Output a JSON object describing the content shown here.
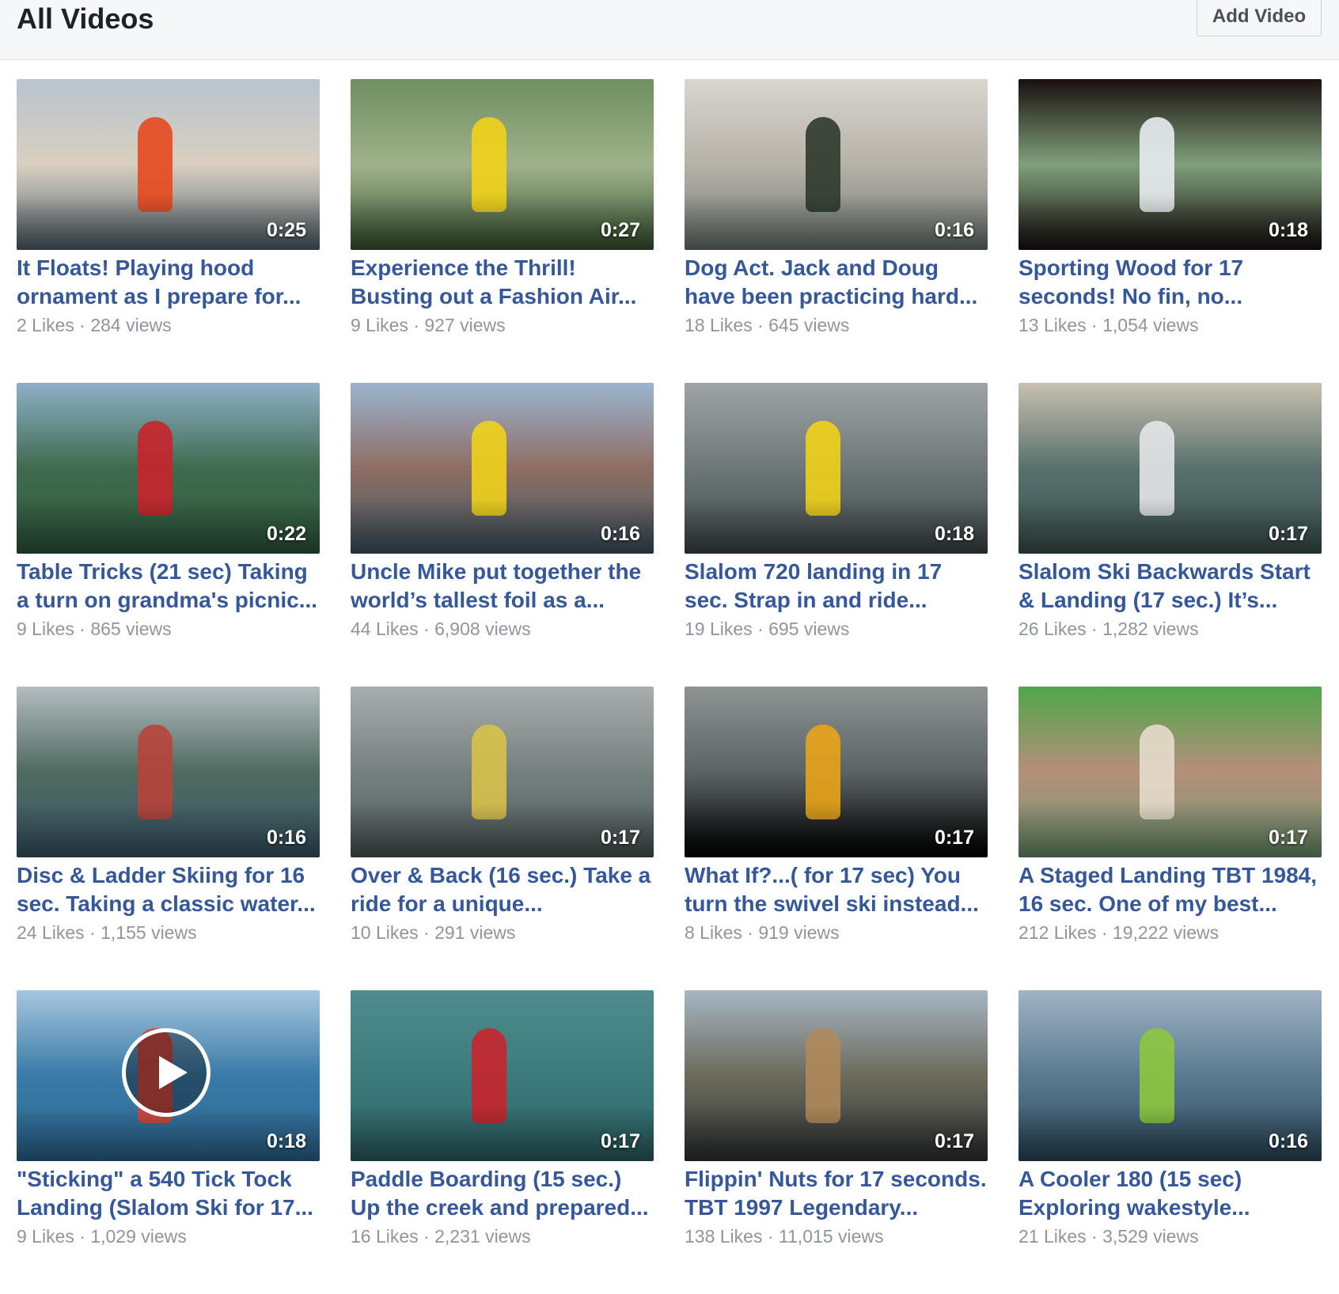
{
  "header": {
    "title": "All Videos",
    "add_button_label": "Add Video"
  },
  "videos": [
    {
      "duration": "0:25",
      "title": "It Floats! Playing hood ornament as I prepare for...",
      "likes": "2 Likes",
      "views": "284 views",
      "colors": [
        "#b9c4cf",
        "#d8cfc0",
        "#556872"
      ],
      "accent": "#e5491e"
    },
    {
      "duration": "0:27",
      "title": "Experience the Thrill! Busting out a Fashion Air...",
      "likes": "9 Likes",
      "views": "927 views",
      "colors": [
        "#6f8f62",
        "#9fb18a",
        "#3d5a34"
      ],
      "accent": "#f2d21a"
    },
    {
      "duration": "0:16",
      "title": "Dog Act. Jack and Doug have been practicing hard...",
      "likes": "18 Likes",
      "views": "645 views",
      "colors": [
        "#d9d6cf",
        "#b7b2a8",
        "#6f7b74"
      ],
      "accent": "#2e3a2c"
    },
    {
      "duration": "0:18",
      "title": "Sporting Wood for 17 seconds! No fin, no...",
      "likes": "13 Likes",
      "views": "1,054 views",
      "colors": [
        "#1a1010",
        "#7fa07a",
        "#1a1010"
      ],
      "accent": "#e8ecef"
    },
    {
      "duration": "0:22",
      "title": "Table Tricks (21 sec) Taking a turn on grandma's picnic...",
      "likes": "9 Likes",
      "views": "865 views",
      "colors": [
        "#8fb0c8",
        "#3f6a4e",
        "#2f5c3f"
      ],
      "accent": "#c9232b"
    },
    {
      "duration": "0:16",
      "title": "Uncle Mike put together the world’s tallest foil as a...",
      "likes": "44 Likes",
      "views": "6,908 views",
      "colors": [
        "#9cb4cf",
        "#8e6e64",
        "#3f5866"
      ],
      "accent": "#f0d21a"
    },
    {
      "duration": "0:18",
      "title": "Slalom 720 landing in 17 sec. Strap in and ride...",
      "likes": "19 Likes",
      "views": "695 views",
      "colors": [
        "#9ea4a6",
        "#6d7778",
        "#3f4a4c"
      ],
      "accent": "#f2d21a"
    },
    {
      "duration": "0:17",
      "title": "Slalom Ski Backwards Start & Landing (17 sec.) It’s...",
      "likes": "26 Likes",
      "views": "1,282 views",
      "colors": [
        "#c8c1b0",
        "#58706d",
        "#3d5552"
      ],
      "accent": "#e4e6e8"
    },
    {
      "duration": "0:16",
      "title": "Disc & Ladder Skiing for 16 sec. Taking a classic water...",
      "likes": "24 Likes",
      "views": "1,155 views",
      "colors": [
        "#b4bcc0",
        "#4f6a60",
        "#3b5a6c"
      ],
      "accent": "#b8443a"
    },
    {
      "duration": "0:17",
      "title": "Over & Back (16 sec.) Take a ride for a unique...",
      "likes": "10 Likes",
      "views": "291 views",
      "colors": [
        "#a9aeae",
        "#75807f",
        "#4e5a5a"
      ],
      "accent": "#d8c24a"
    },
    {
      "duration": "0:17",
      "title": "What If?...( for 17 sec) You turn the swivel ski instead...",
      "likes": "8 Likes",
      "views": "919 views",
      "colors": [
        "#8e9494",
        "#5b6366",
        "#000000"
      ],
      "accent": "#e8a41a"
    },
    {
      "duration": "0:17",
      "title": "A Staged Landing TBT 1984, 16 sec. One of my best...",
      "likes": "212 Likes",
      "views": "19,222 views",
      "colors": [
        "#4fa64a",
        "#b58f7a",
        "#6f9a72"
      ],
      "accent": "#e6dccc"
    },
    {
      "duration": "0:18",
      "title": "\"Sticking\" a 540 Tick Tock Landing (Slalom Ski for 17...",
      "likes": "9 Likes",
      "views": "1,029 views",
      "colors": [
        "#a5c7e0",
        "#3a7aa6",
        "#2e6c98"
      ],
      "accent": "#d8453a",
      "play": true
    },
    {
      "duration": "0:17",
      "title": "Paddle Boarding (15 sec.) Up the creek and prepared...",
      "likes": "16 Likes",
      "views": "2,231 views",
      "colors": [
        "#4f8c8f",
        "#3c7a7c",
        "#2d6466"
      ],
      "accent": "#c9232b"
    },
    {
      "duration": "0:17",
      "title": "Flippin' Nuts for 17 seconds. TBT 1997 Legendary...",
      "likes": "138 Likes",
      "views": "11,015 views",
      "colors": [
        "#a7b6c4",
        "#6c6b5c",
        "#303436"
      ],
      "accent": "#b08a5a"
    },
    {
      "duration": "0:16",
      "title": "A Cooler 180 (15 sec) Exploring wakestyle...",
      "likes": "21 Likes",
      "views": "3,529 views",
      "colors": [
        "#9fb3c4",
        "#5a7a90",
        "#2c4a5e"
      ],
      "accent": "#8cc63f"
    }
  ]
}
